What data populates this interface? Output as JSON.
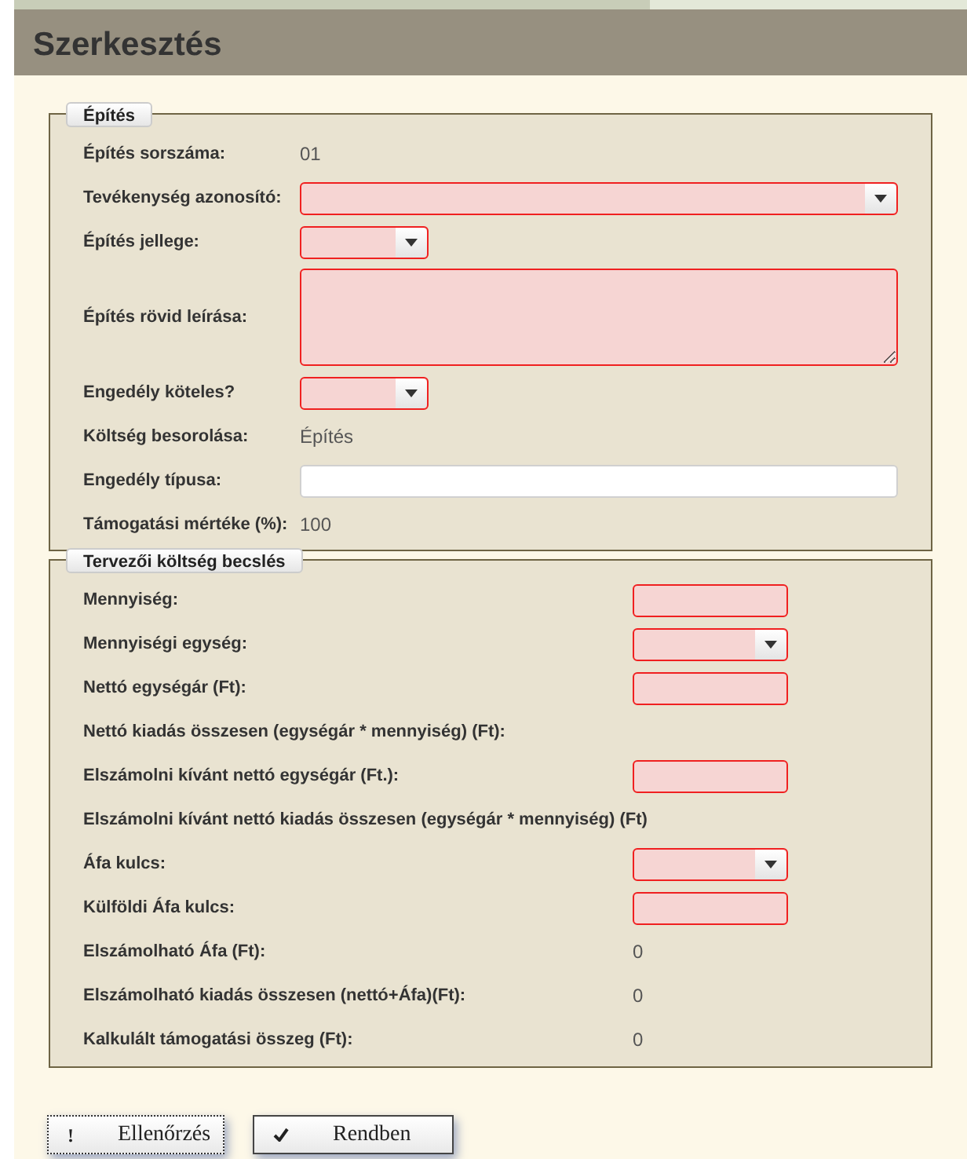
{
  "dialog": {
    "title": "Szerkesztés"
  },
  "sections": [
    {
      "legend": "Építés",
      "fields": [
        {
          "label": "Építés sorszáma:",
          "kind": "value",
          "value": "01"
        },
        {
          "label": "Tevékenység azonosító:",
          "kind": "wide-select",
          "invalid": true
        },
        {
          "label": "Építés jellege:",
          "kind": "short-select",
          "invalid": true
        },
        {
          "label": "Építés rövid leírása:",
          "kind": "textarea",
          "invalid": true
        },
        {
          "label": "Engedély köteles?",
          "kind": "short-select",
          "invalid": true
        },
        {
          "label": "Költség besorolása:",
          "kind": "value",
          "value": "Építés"
        },
        {
          "label": "Engedély típusa:",
          "kind": "wide-text",
          "invalid": false
        },
        {
          "label": "Támogatási mértéke (%):",
          "kind": "value",
          "value": "100"
        }
      ]
    },
    {
      "legend": "Tervezői költség becslés",
      "fields": [
        {
          "label": "Mennyiség:",
          "kind": "text",
          "invalid": true
        },
        {
          "label": "Mennyiségi egység:",
          "kind": "select",
          "invalid": true
        },
        {
          "label": "Nettó egységár (Ft):",
          "kind": "text",
          "invalid": true
        },
        {
          "label": "Nettó kiadás összesen (egységár * mennyiség) (Ft):",
          "kind": "value"
        },
        {
          "label": "Elszámolni kívánt nettó egységár (Ft.):",
          "kind": "text",
          "invalid": true
        },
        {
          "label": "Elszámolni kívánt nettó kiadás összesen (egységár * mennyiség) (Ft)",
          "kind": "value"
        },
        {
          "label": "Áfa kulcs:",
          "kind": "select",
          "invalid": true
        },
        {
          "label": "Külföldi Áfa kulcs:",
          "kind": "text",
          "invalid": true
        },
        {
          "label": "Elszámolható Áfa (Ft):",
          "kind": "value",
          "value": "0"
        },
        {
          "label": "Elszámolható kiadás összesen (nettó+Áfa)(Ft):",
          "kind": "value",
          "value": "0"
        },
        {
          "label": "Kalkulált támogatási összeg (Ft):",
          "kind": "value",
          "value": "0"
        }
      ]
    }
  ],
  "buttons": [
    {
      "label": "Ellenőrzés",
      "icon": "!"
    },
    {
      "label": "Rendben",
      "kind": "check"
    }
  ]
}
